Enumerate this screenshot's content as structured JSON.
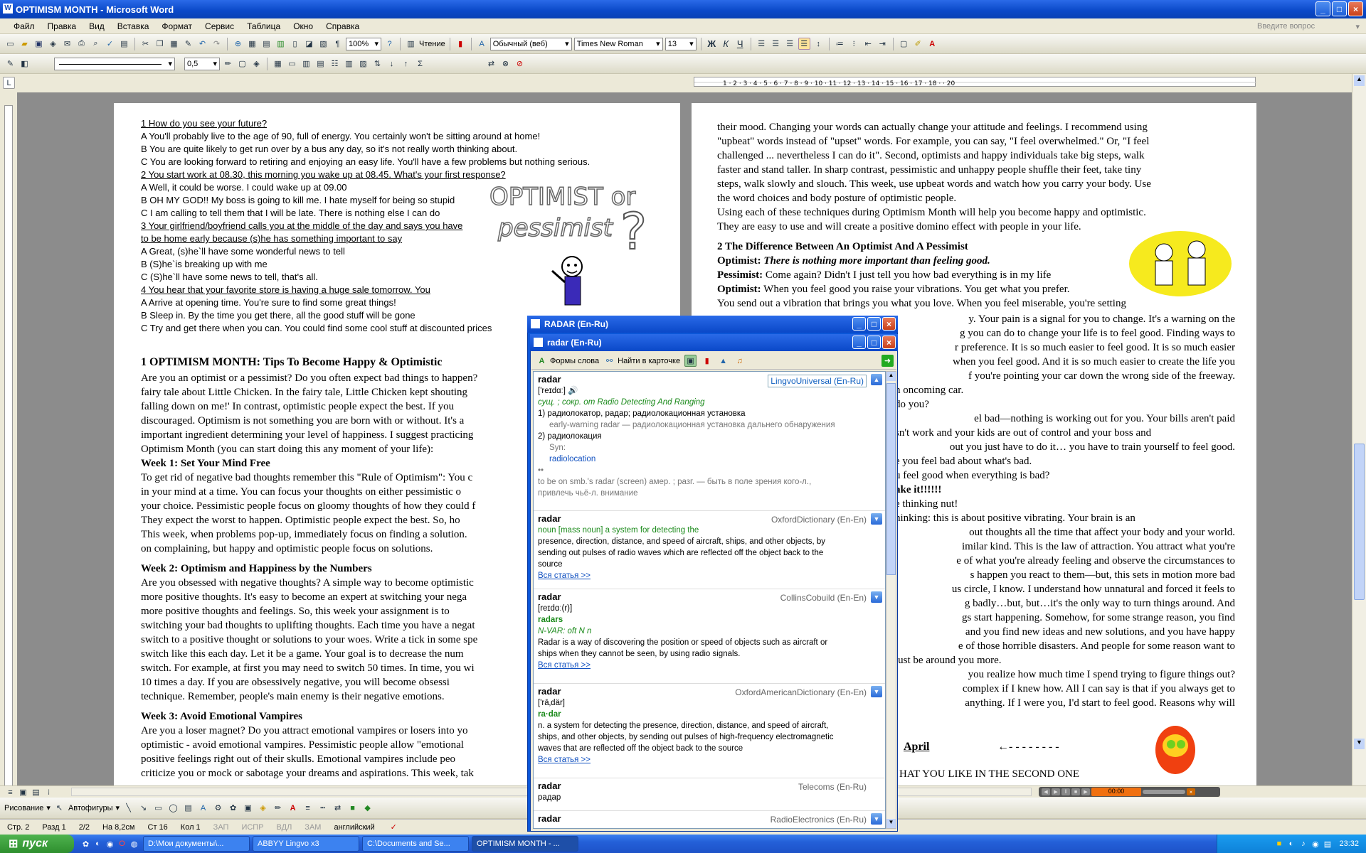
{
  "window": {
    "title": "OPTIMISM MONTH - Microsoft Word",
    "minimize": "_",
    "maximize": "□",
    "close": "×"
  },
  "menu": [
    "Файл",
    "Правка",
    "Вид",
    "Вставка",
    "Формат",
    "Сервис",
    "Таблица",
    "Окно",
    "Справка"
  ],
  "help_box": {
    "placeholder": "Введите вопрос"
  },
  "toolbar": {
    "zoom": "100%",
    "read_label": "Чтение",
    "style": "Обычный (веб)",
    "font": "Times New Roman",
    "size": "13",
    "line_width": "0,5",
    "bold": "Ж",
    "italic": "К",
    "underline": "Ч"
  },
  "quiz": {
    "q1": "1   How do you see your future?",
    "q1a": "A  You'll probably live to the age of 90, full of energy. You certainly won't be sitting around at home!",
    "q1b": "B  You are quite likely to get run over by a bus any day, so it's not really worth thinking about.",
    "q1c": "C  You are looking forward to retiring and enjoying an easy life. You'll have a few problems but nothing serious.",
    "q2": "2  You start work  at 08.30, this morning you wake up at 08.45. What's your first response?",
    "q2a": "A   Well, it could be worse. I could wake up at 09.00",
    "q2b": "B   OH MY GOD!! My boss is going to kill me. I hate myself for being so stupid",
    "q2c": "C  I am calling to tell them that I will be late. There is nothing else I can do",
    "q3": "3 Your girlfriend/boyfriend calls you at the middle of the day and says you have",
    "q3b2": "to be home early  because (s)he has something important to say",
    "q3a": "A   Great, (s)he`ll have some wonderful news to tell",
    "q3b": "B  (S)he`is breaking up with me",
    "q3c": "C  (S)he`ll have some news to tell, that's all.",
    "q4": "4 You hear that your favorite store is having a huge sale tomorrow. You",
    "q4a": "A   Arrive at opening time. You're sure to find some great things!",
    "q4b": "B  Sleep in. By the time you get there, all the good stuff will be gone",
    "q4c": "C  Try and get there when you can. You could find some cool stuff at discounted prices"
  },
  "wordart": {
    "line1": "OPTIMIST or",
    "line2": "pessimist",
    "q": "?"
  },
  "page1": {
    "h1": "1 OPTIMISM MONTH: Tips To Become Happy & Optimistic",
    "p1": [
      "Are you an optimist or a pessimist? Do you often expect bad things to happen?",
      "fairy tale about Little Chicken. In the fairy tale, Little Chicken kept shouting",
      "falling down on me!' In contrast, optimistic people expect the best. If you",
      "discouraged. Optimism is not something you are born with or without. It's a",
      "important ingredient determining your level of happiness.  I suggest practicing",
      "Optimism Month (you can start doing this any moment of your life):"
    ],
    "w1": "Week 1: Set Your Mind Free",
    "p2": [
      "To get rid of negative bad thoughts remember this \"Rule of Optimism\":  You c",
      "in your mind at a time.  You can focus your thoughts on either pessimistic o",
      "your choice. Pessimistic people focus on gloomy thoughts of how they could f",
      "They expect the worst to happen. Optimistic people expect the best. So, ho",
      "This week, when problems pop-up, immediately focus on finding a solution.",
      "on complaining, but happy and optimistic people focus on solutions."
    ],
    "w2": "Week 2: Optimism and Happiness by the Numbers",
    "p3": [
      "Are you obsessed with negative thoughts? A simple way to become optimistic",
      "more positive thoughts. It's easy to become an expert at switching your nega",
      "more positive thoughts and feelings. So, this week your assignment is to",
      "switching your bad thoughts to uplifting thoughts. Each time you have a negat",
      "switch to a positive thought or solutions to your woes. Write a tick in some spe",
      "switch like this each day. Let it be a game. Your goal is to decrease the num",
      "switch. For example, at first you may need to switch 50 times. In time, you wi",
      "10 times a day. If you are obsessively negative, you will become obsessi",
      "technique. Remember, people's main enemy is their negative emotions."
    ],
    "w3": "Week 3: Avoid Emotional Vampires",
    "p4": [
      "Are you a loser magnet? Do you attract emotional vampires or losers into yo",
      "optimistic - avoid emotional vampires. Pessimistic people allow \"emotional",
      "positive feelings right out of their skulls. Emotional vampires include peo",
      "criticize you or mock or sabotage your dreams and aspirations. This week, tak"
    ]
  },
  "page2": {
    "p1": [
      "their mood. Changing your words can actually change your attitude and feelings. I recommend using",
      "\"upbeat\" words instead of \"upset\" words. For example, you can say, \"I feel overwhelmed.\" Or, \"I feel",
      "challenged ... nevertheless I can do it\". Second, optimists and happy individuals take big steps, walk",
      "faster and stand taller. In sharp contrast, pessimistic and unhappy people shuffle their feet, take tiny",
      "steps, walk slowly and slouch. This week, use upbeat words and watch how you carry your body. Use",
      "the word choices and body posture of optimistic people.",
      "Using each of these techniques during Optimism Month will help you become happy and optimistic.",
      "They are easy to use and will create a positive domino effect with people in your life."
    ],
    "h2": "2 The Difference Between An Optimist And A Pessimist",
    "o1_label": "Optimist:",
    "o1_text": "There is nothing more important than feeling good.",
    "pe_label": "Pessimist:",
    "pe_text": "Come again? Didn't I just tell you how bad everything is in my life",
    "o2_label": "Optimist:",
    "o2_text": "When you feel good you raise your vibrations. You get what you prefer.",
    "p2": [
      "You send out a vibration that brings you what you love. When you feel miserable, you're setting",
      "y. Your pain is a signal for you to change. It's a warning on the",
      "g you can do to change your life is to feel good. Finding ways to",
      "r preference. It is so much easier to feel good. It is so much easier",
      "when you feel good. And it is so much easier to create the life you",
      "f you're pointing your car down the wrong side of the freeway.",
      "n oncoming car.",
      "do you?",
      "el bad—nothing is working out for you. Your bills aren't paid",
      "sn't work and your kids are out of control and your boss and",
      "out you just have to do it… you have to train yourself to feel good.",
      "e you feel bad about what's bad.",
      "u feel good when everything is bad?",
      "ake it!!!!!!",
      "e thinking nut!",
      "hinking: this is about positive vibrating. Your brain is an",
      "out thoughts all the time that affect your body and your world.",
      "imilar kind. This is the law of attraction. You attract what you're",
      "e of what you're already feeling and observe the circumstances to",
      "s happen you react to them—but, this sets in motion more bad",
      "us circle, I know. I understand how unnatural and forced it feels to",
      "g badly…but, but…it's the only way to turn things around. And",
      "gs start happening. Somehow, for some strange reason, you find",
      "and you find new ideas and new solutions, and you have happy",
      "e of those horrible disasters. And people for some reason want to",
      "just be around you more.",
      "you realize how much time I spend trying to figure things out?",
      "complex if I knew how. All I can say is that if you always get to",
      "anything. If I were you, I'd start to feel good. Reasons why will"
    ],
    "april": "April",
    "arrow": "←- - - - - - - -",
    "bottom": "HAT YOU LIKE IN THE SECOND ONE"
  },
  "lingvo": {
    "outer_title": "RADAR (En-Ru)",
    "inner_title": "radar (En-Ru)",
    "btn_forms": "Формы слова",
    "btn_find": "Найти в карточке",
    "articles": [
      {
        "word": "radar",
        "dict": "LingvoUniversal (En-Ru)",
        "lines": [
          "['reɪdɑː]",
          "сущ. ; сокр. от Radio Detecting And Ranging",
          "1) радиолокатор, радар; радиолокационная установка",
          "early-warning radar — радиолокационная установка дальнего обнаружения",
          "2) радиолокация",
          "Syn:",
          "radiolocation",
          "••",
          "to be on smb.'s radar (screen) амер. ; разг. — быть в поле зрения кого-л.,",
          "привлечь чьё-л. внимание"
        ]
      },
      {
        "word": "radar",
        "dict": "OxfordDictionary (En-En)",
        "lines": [
          "noun [mass noun] a system for detecting the",
          "presence, direction, distance, and speed of aircraft, ships, and other objects, by",
          "sending out pulses of radio waves which are reflected off the object back to the",
          "source",
          "Вся статья >>"
        ]
      },
      {
        "word": "radar",
        "dict": "CollinsCobuild (En-En)",
        "lines": [
          "[reɪdɑː(r)]",
          "radars",
          "N-VAR: oft N n",
          "Radar is a way of discovering the position or speed of objects such as aircraft or",
          "ships when they cannot be seen, by using radio signals.",
          "Вся статья >>"
        ]
      },
      {
        "word": "radar",
        "dict": "OxfordAmericanDictionary (En-En)",
        "lines": [
          "['rā‚där]",
          "ra·dar",
          "n. a system for detecting the presence, direction, distance, and speed of aircraft,",
          "ships, and other objects, by sending out pulses of high-frequency electromagnetic",
          "waves that are reflected off the object back to the source",
          "Вся статья >>"
        ]
      },
      {
        "word": "radar",
        "dict": "Telecoms (En-Ru)",
        "lines": [
          "радар"
        ]
      },
      {
        "word": "radar",
        "dict": "RadioElectronics (En-Ru)",
        "lines": []
      }
    ]
  },
  "drawbar": {
    "draw": "Рисование",
    "autoshapes": "Автофигуры"
  },
  "status": {
    "page": "Стр. 2",
    "section": "Разд 1",
    "pages": "2/2",
    "at": "На 8,2см",
    "line": "Ст 16",
    "col": "Кол 1",
    "rec": "ЗАП",
    "trk": "ИСПР",
    "ext": "ВДЛ",
    "ovr": "ЗАМ",
    "lang": "английский"
  },
  "player": {
    "time": "00:00"
  },
  "taskbar": {
    "start": "пуск",
    "tasks": [
      "D:\\Мои документы\\...",
      "ABBYY Lingvo x3",
      "C:\\Documents and Se...",
      "OPTIMISM MONTH - ..."
    ],
    "clock": "23:32"
  }
}
